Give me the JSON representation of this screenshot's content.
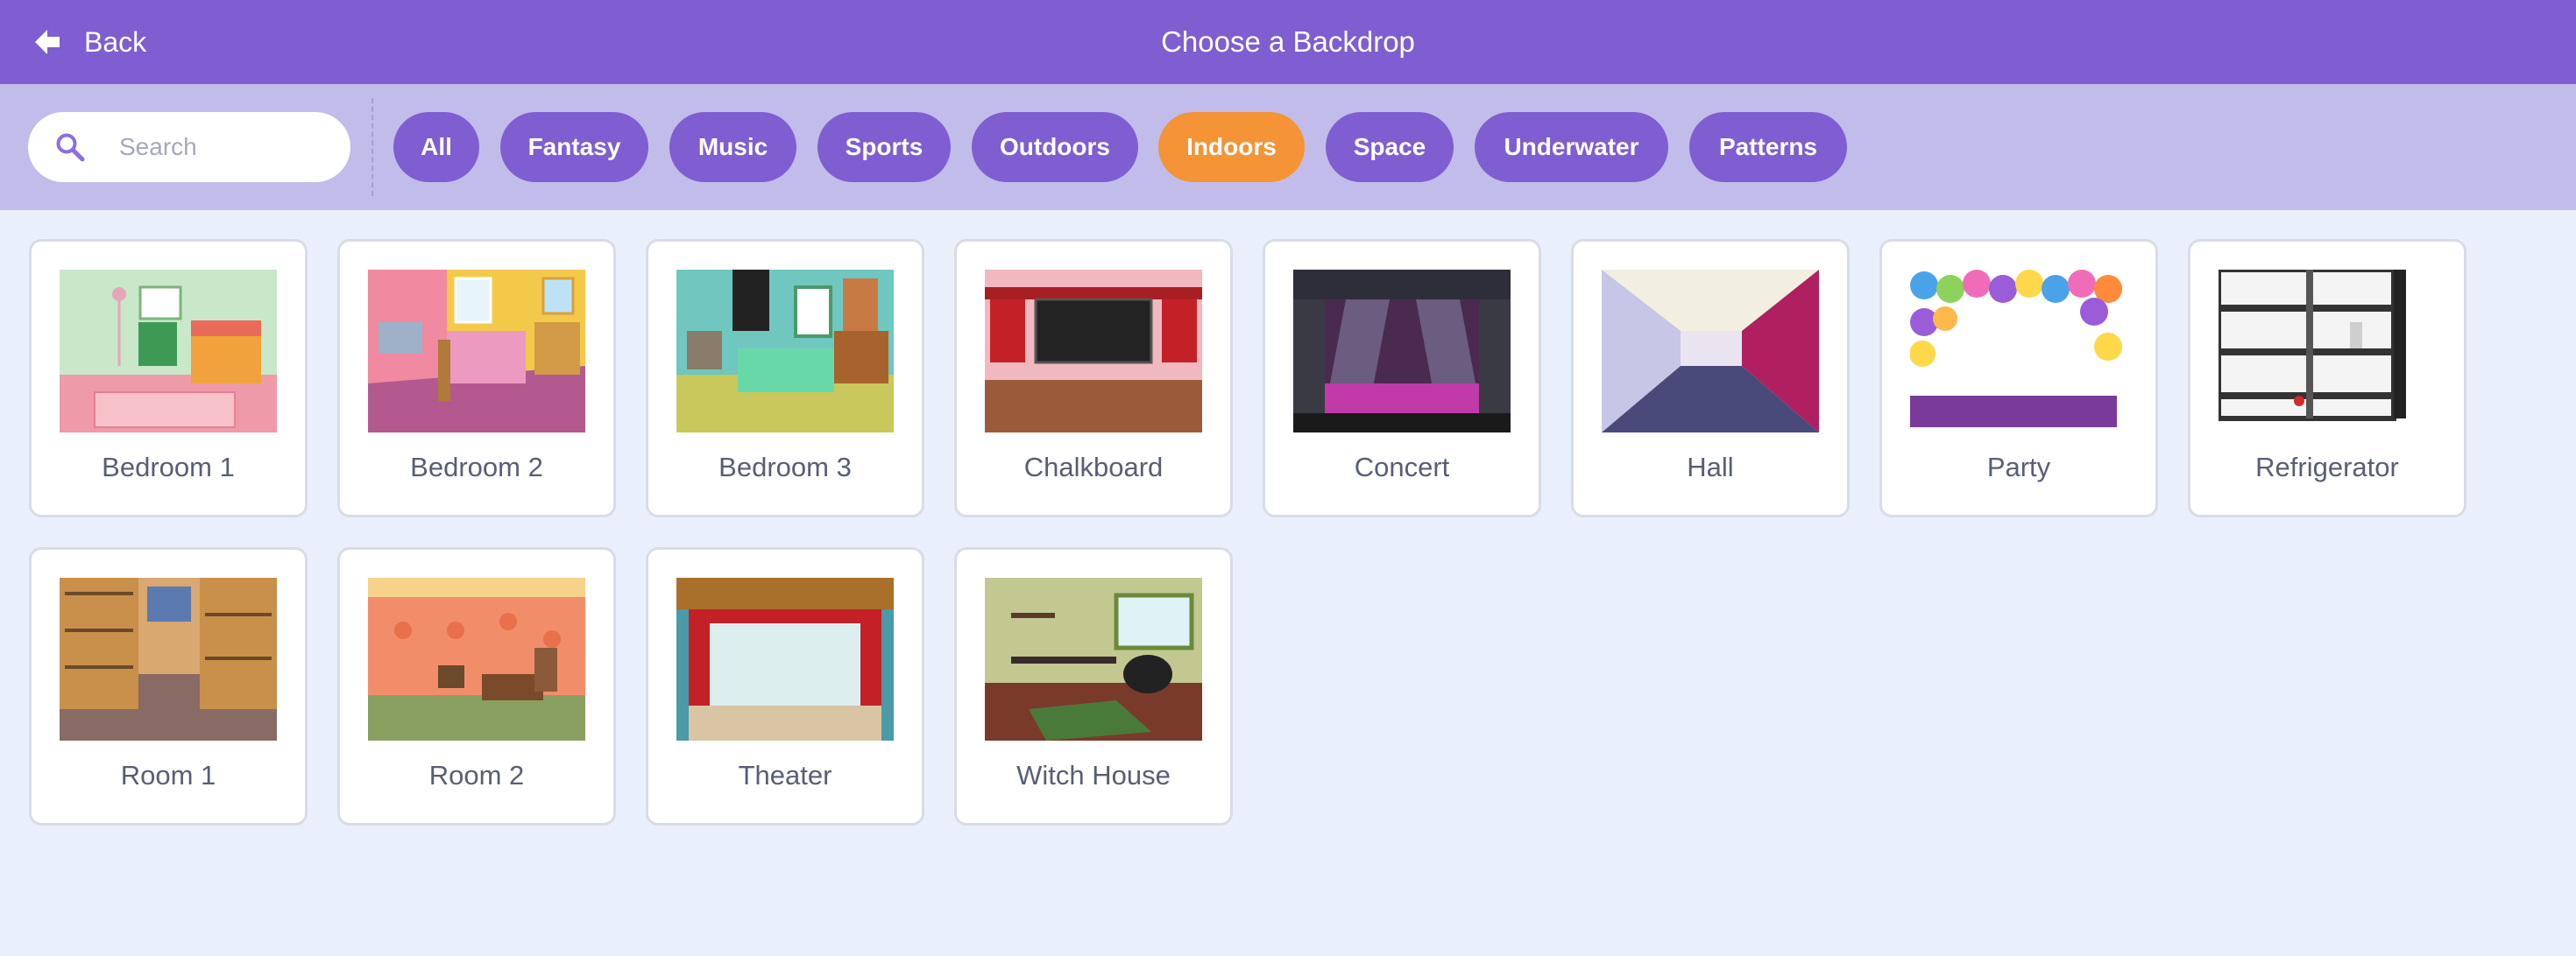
{
  "header": {
    "back_label": "Back",
    "title": "Choose a Backdrop"
  },
  "search": {
    "placeholder": "Search",
    "value": ""
  },
  "tags": [
    {
      "label": "All",
      "active": false
    },
    {
      "label": "Fantasy",
      "active": false
    },
    {
      "label": "Music",
      "active": false
    },
    {
      "label": "Sports",
      "active": false
    },
    {
      "label": "Outdoors",
      "active": false
    },
    {
      "label": "Indoors",
      "active": true
    },
    {
      "label": "Space",
      "active": false
    },
    {
      "label": "Underwater",
      "active": false
    },
    {
      "label": "Patterns",
      "active": false
    }
  ],
  "backdrops": [
    {
      "name": "Bedroom 1"
    },
    {
      "name": "Bedroom 2"
    },
    {
      "name": "Bedroom 3"
    },
    {
      "name": "Chalkboard"
    },
    {
      "name": "Concert"
    },
    {
      "name": "Hall"
    },
    {
      "name": "Party"
    },
    {
      "name": "Refrigerator"
    },
    {
      "name": "Room 1"
    },
    {
      "name": "Room 2"
    },
    {
      "name": "Theater"
    },
    {
      "name": "Witch House"
    }
  ],
  "colors": {
    "header": "#7e5ed0",
    "filterbar": "#c2bceb",
    "tag": "#7e5ed0",
    "tag_active": "#f49436",
    "background": "#e9f0fb"
  }
}
